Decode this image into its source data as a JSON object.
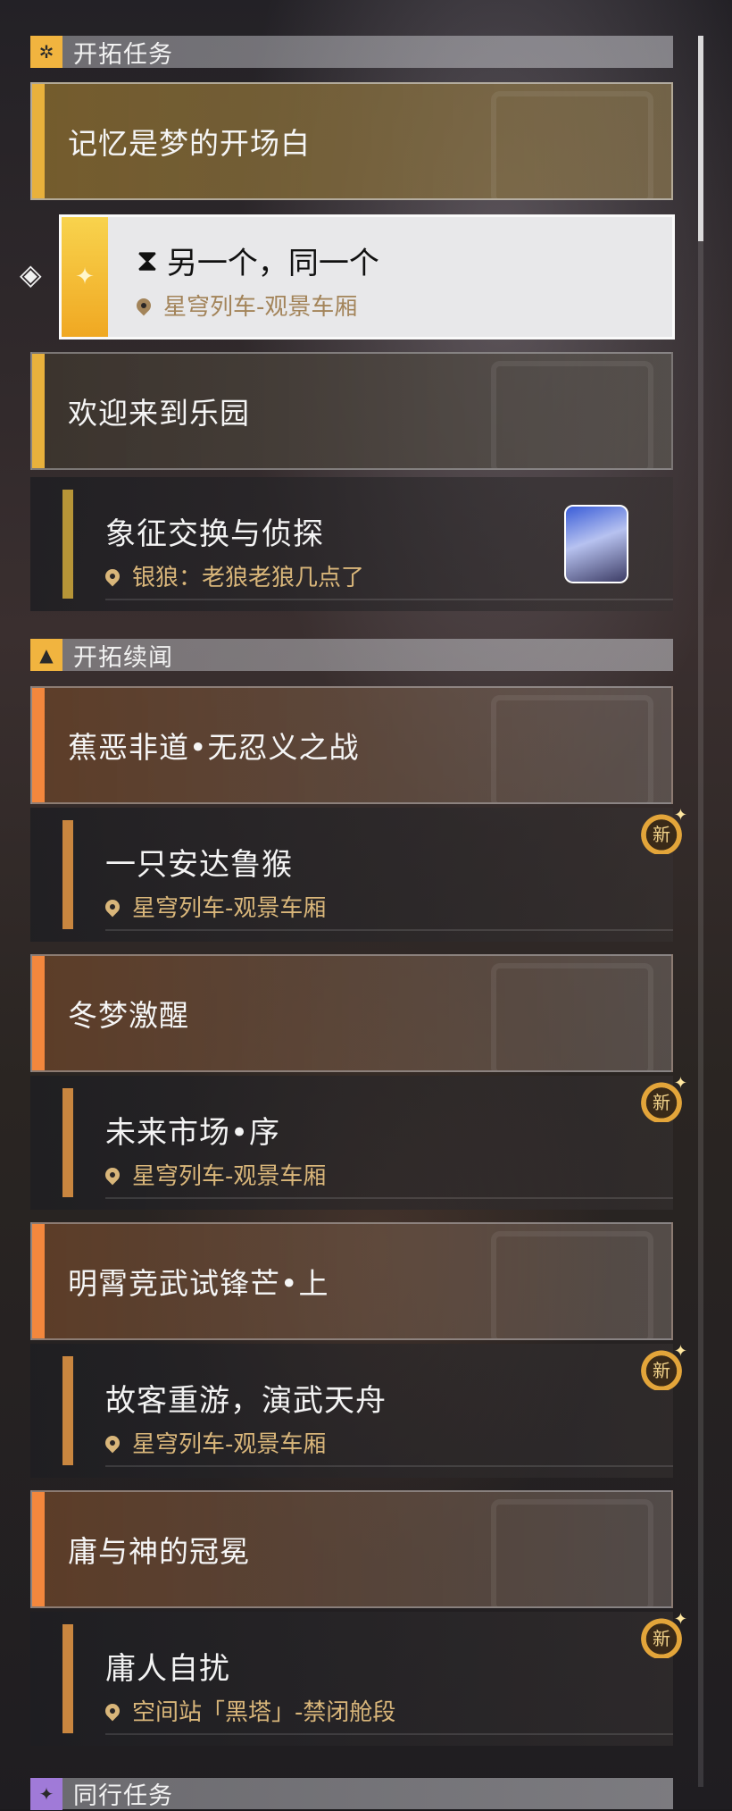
{
  "sections": {
    "trailblaze": {
      "label": "开拓任务",
      "icon": "trailblaze-mission-icon"
    },
    "continuance": {
      "label": "开拓续闻",
      "icon": "trailblaze-continuance-icon"
    },
    "companion": {
      "label": "同行任务",
      "icon": "companion-mission-icon"
    }
  },
  "groups": [
    {
      "title": "记忆是梦的开场白"
    },
    {
      "title": "欢迎来到乐园"
    },
    {
      "title": "蕉恶非道•无忍义之战"
    },
    {
      "title": "冬梦激醒"
    },
    {
      "title": "明霄竞武试锋芒•上"
    },
    {
      "title": "庸与神的冠冕"
    }
  ],
  "selected_quest": {
    "name": "另一个，同一个",
    "location": "星穹列车-观景车厢",
    "icon": "hourglass-icon"
  },
  "quests": [
    {
      "name": "象征交换与侦探",
      "location": "银狼：老狼老狼几点了"
    },
    {
      "name": "一只安达鲁猴",
      "location": "星穹列车-观景车厢",
      "badge": "新"
    },
    {
      "name": "未来市场•序",
      "location": "星穹列车-观景车厢",
      "badge": "新"
    },
    {
      "name": "故客重游，演武天舟",
      "location": "星穹列车-观景车厢",
      "badge": "新"
    },
    {
      "name": "庸人自扰",
      "location": "空间站「黑塔」-禁闭舱段",
      "badge": "新"
    }
  ]
}
